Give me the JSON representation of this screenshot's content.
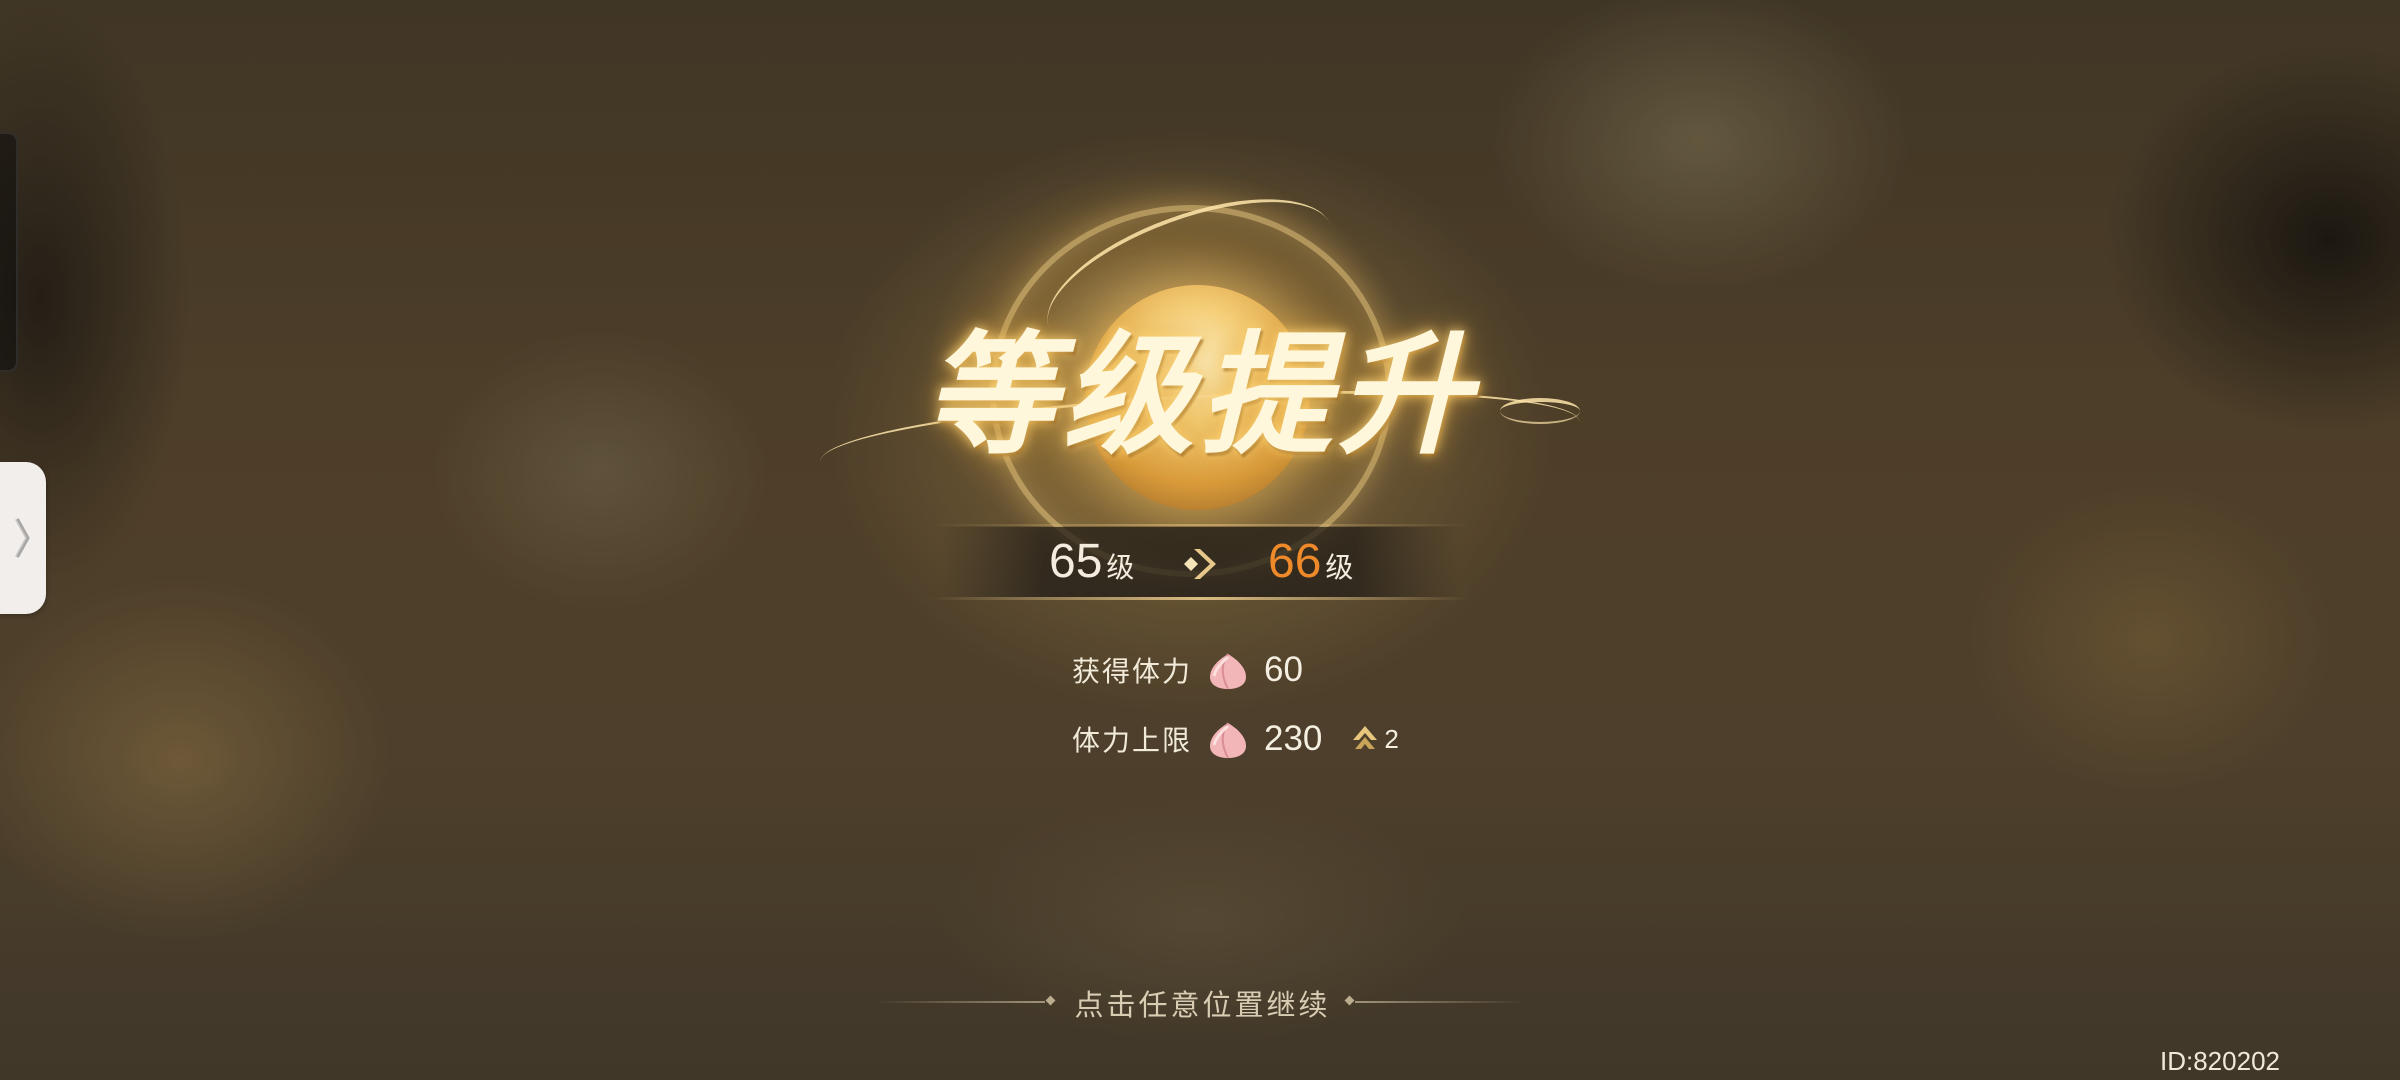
{
  "title": "等级提升",
  "level": {
    "from_value": "65",
    "from_unit": "级",
    "to_value": "66",
    "to_unit": "级"
  },
  "rewards": [
    {
      "label": "获得体力",
      "icon": "peach-icon",
      "value": "60"
    },
    {
      "label": "体力上限",
      "icon": "peach-icon",
      "value": "230",
      "increase_icon": "up-arrow-icon",
      "increase": "2"
    }
  ],
  "continue_hint": "点击任意位置继续",
  "player_id": "ID:820202",
  "colors": {
    "title_glow": "#ffd778",
    "new_level": "#ef8a2a",
    "text_light": "#f3ecdf",
    "hint_text": "#d8ccb2"
  }
}
